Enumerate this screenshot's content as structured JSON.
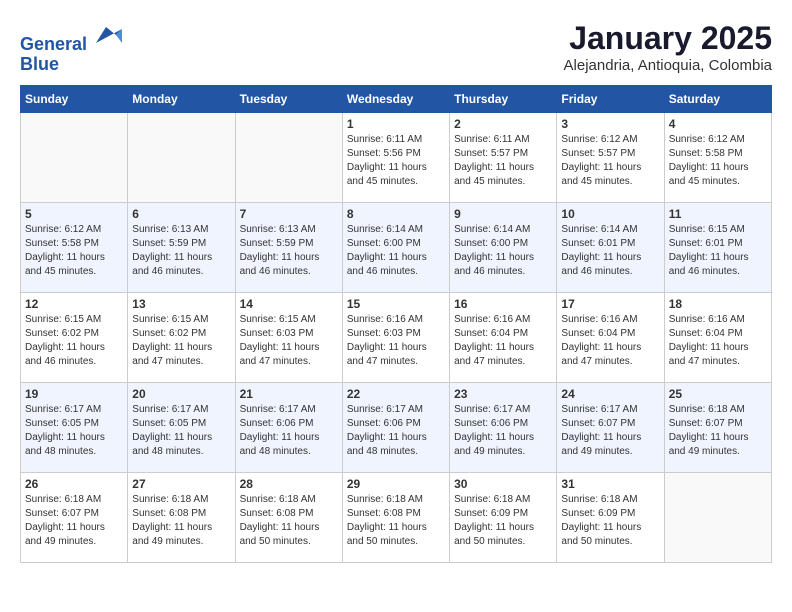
{
  "header": {
    "logo_line1": "General",
    "logo_line2": "Blue",
    "title": "January 2025",
    "subtitle": "Alejandria, Antioquia, Colombia"
  },
  "weekdays": [
    "Sunday",
    "Monday",
    "Tuesday",
    "Wednesday",
    "Thursday",
    "Friday",
    "Saturday"
  ],
  "weeks": [
    [
      {
        "day": "",
        "text": ""
      },
      {
        "day": "",
        "text": ""
      },
      {
        "day": "",
        "text": ""
      },
      {
        "day": "1",
        "text": "Sunrise: 6:11 AM\nSunset: 5:56 PM\nDaylight: 11 hours\nand 45 minutes."
      },
      {
        "day": "2",
        "text": "Sunrise: 6:11 AM\nSunset: 5:57 PM\nDaylight: 11 hours\nand 45 minutes."
      },
      {
        "day": "3",
        "text": "Sunrise: 6:12 AM\nSunset: 5:57 PM\nDaylight: 11 hours\nand 45 minutes."
      },
      {
        "day": "4",
        "text": "Sunrise: 6:12 AM\nSunset: 5:58 PM\nDaylight: 11 hours\nand 45 minutes."
      }
    ],
    [
      {
        "day": "5",
        "text": "Sunrise: 6:12 AM\nSunset: 5:58 PM\nDaylight: 11 hours\nand 45 minutes."
      },
      {
        "day": "6",
        "text": "Sunrise: 6:13 AM\nSunset: 5:59 PM\nDaylight: 11 hours\nand 46 minutes."
      },
      {
        "day": "7",
        "text": "Sunrise: 6:13 AM\nSunset: 5:59 PM\nDaylight: 11 hours\nand 46 minutes."
      },
      {
        "day": "8",
        "text": "Sunrise: 6:14 AM\nSunset: 6:00 PM\nDaylight: 11 hours\nand 46 minutes."
      },
      {
        "day": "9",
        "text": "Sunrise: 6:14 AM\nSunset: 6:00 PM\nDaylight: 11 hours\nand 46 minutes."
      },
      {
        "day": "10",
        "text": "Sunrise: 6:14 AM\nSunset: 6:01 PM\nDaylight: 11 hours\nand 46 minutes."
      },
      {
        "day": "11",
        "text": "Sunrise: 6:15 AM\nSunset: 6:01 PM\nDaylight: 11 hours\nand 46 minutes."
      }
    ],
    [
      {
        "day": "12",
        "text": "Sunrise: 6:15 AM\nSunset: 6:02 PM\nDaylight: 11 hours\nand 46 minutes."
      },
      {
        "day": "13",
        "text": "Sunrise: 6:15 AM\nSunset: 6:02 PM\nDaylight: 11 hours\nand 47 minutes."
      },
      {
        "day": "14",
        "text": "Sunrise: 6:15 AM\nSunset: 6:03 PM\nDaylight: 11 hours\nand 47 minutes."
      },
      {
        "day": "15",
        "text": "Sunrise: 6:16 AM\nSunset: 6:03 PM\nDaylight: 11 hours\nand 47 minutes."
      },
      {
        "day": "16",
        "text": "Sunrise: 6:16 AM\nSunset: 6:04 PM\nDaylight: 11 hours\nand 47 minutes."
      },
      {
        "day": "17",
        "text": "Sunrise: 6:16 AM\nSunset: 6:04 PM\nDaylight: 11 hours\nand 47 minutes."
      },
      {
        "day": "18",
        "text": "Sunrise: 6:16 AM\nSunset: 6:04 PM\nDaylight: 11 hours\nand 47 minutes."
      }
    ],
    [
      {
        "day": "19",
        "text": "Sunrise: 6:17 AM\nSunset: 6:05 PM\nDaylight: 11 hours\nand 48 minutes."
      },
      {
        "day": "20",
        "text": "Sunrise: 6:17 AM\nSunset: 6:05 PM\nDaylight: 11 hours\nand 48 minutes."
      },
      {
        "day": "21",
        "text": "Sunrise: 6:17 AM\nSunset: 6:06 PM\nDaylight: 11 hours\nand 48 minutes."
      },
      {
        "day": "22",
        "text": "Sunrise: 6:17 AM\nSunset: 6:06 PM\nDaylight: 11 hours\nand 48 minutes."
      },
      {
        "day": "23",
        "text": "Sunrise: 6:17 AM\nSunset: 6:06 PM\nDaylight: 11 hours\nand 49 minutes."
      },
      {
        "day": "24",
        "text": "Sunrise: 6:17 AM\nSunset: 6:07 PM\nDaylight: 11 hours\nand 49 minutes."
      },
      {
        "day": "25",
        "text": "Sunrise: 6:18 AM\nSunset: 6:07 PM\nDaylight: 11 hours\nand 49 minutes."
      }
    ],
    [
      {
        "day": "26",
        "text": "Sunrise: 6:18 AM\nSunset: 6:07 PM\nDaylight: 11 hours\nand 49 minutes."
      },
      {
        "day": "27",
        "text": "Sunrise: 6:18 AM\nSunset: 6:08 PM\nDaylight: 11 hours\nand 49 minutes."
      },
      {
        "day": "28",
        "text": "Sunrise: 6:18 AM\nSunset: 6:08 PM\nDaylight: 11 hours\nand 50 minutes."
      },
      {
        "day": "29",
        "text": "Sunrise: 6:18 AM\nSunset: 6:08 PM\nDaylight: 11 hours\nand 50 minutes."
      },
      {
        "day": "30",
        "text": "Sunrise: 6:18 AM\nSunset: 6:09 PM\nDaylight: 11 hours\nand 50 minutes."
      },
      {
        "day": "31",
        "text": "Sunrise: 6:18 AM\nSunset: 6:09 PM\nDaylight: 11 hours\nand 50 minutes."
      },
      {
        "day": "",
        "text": ""
      }
    ]
  ]
}
